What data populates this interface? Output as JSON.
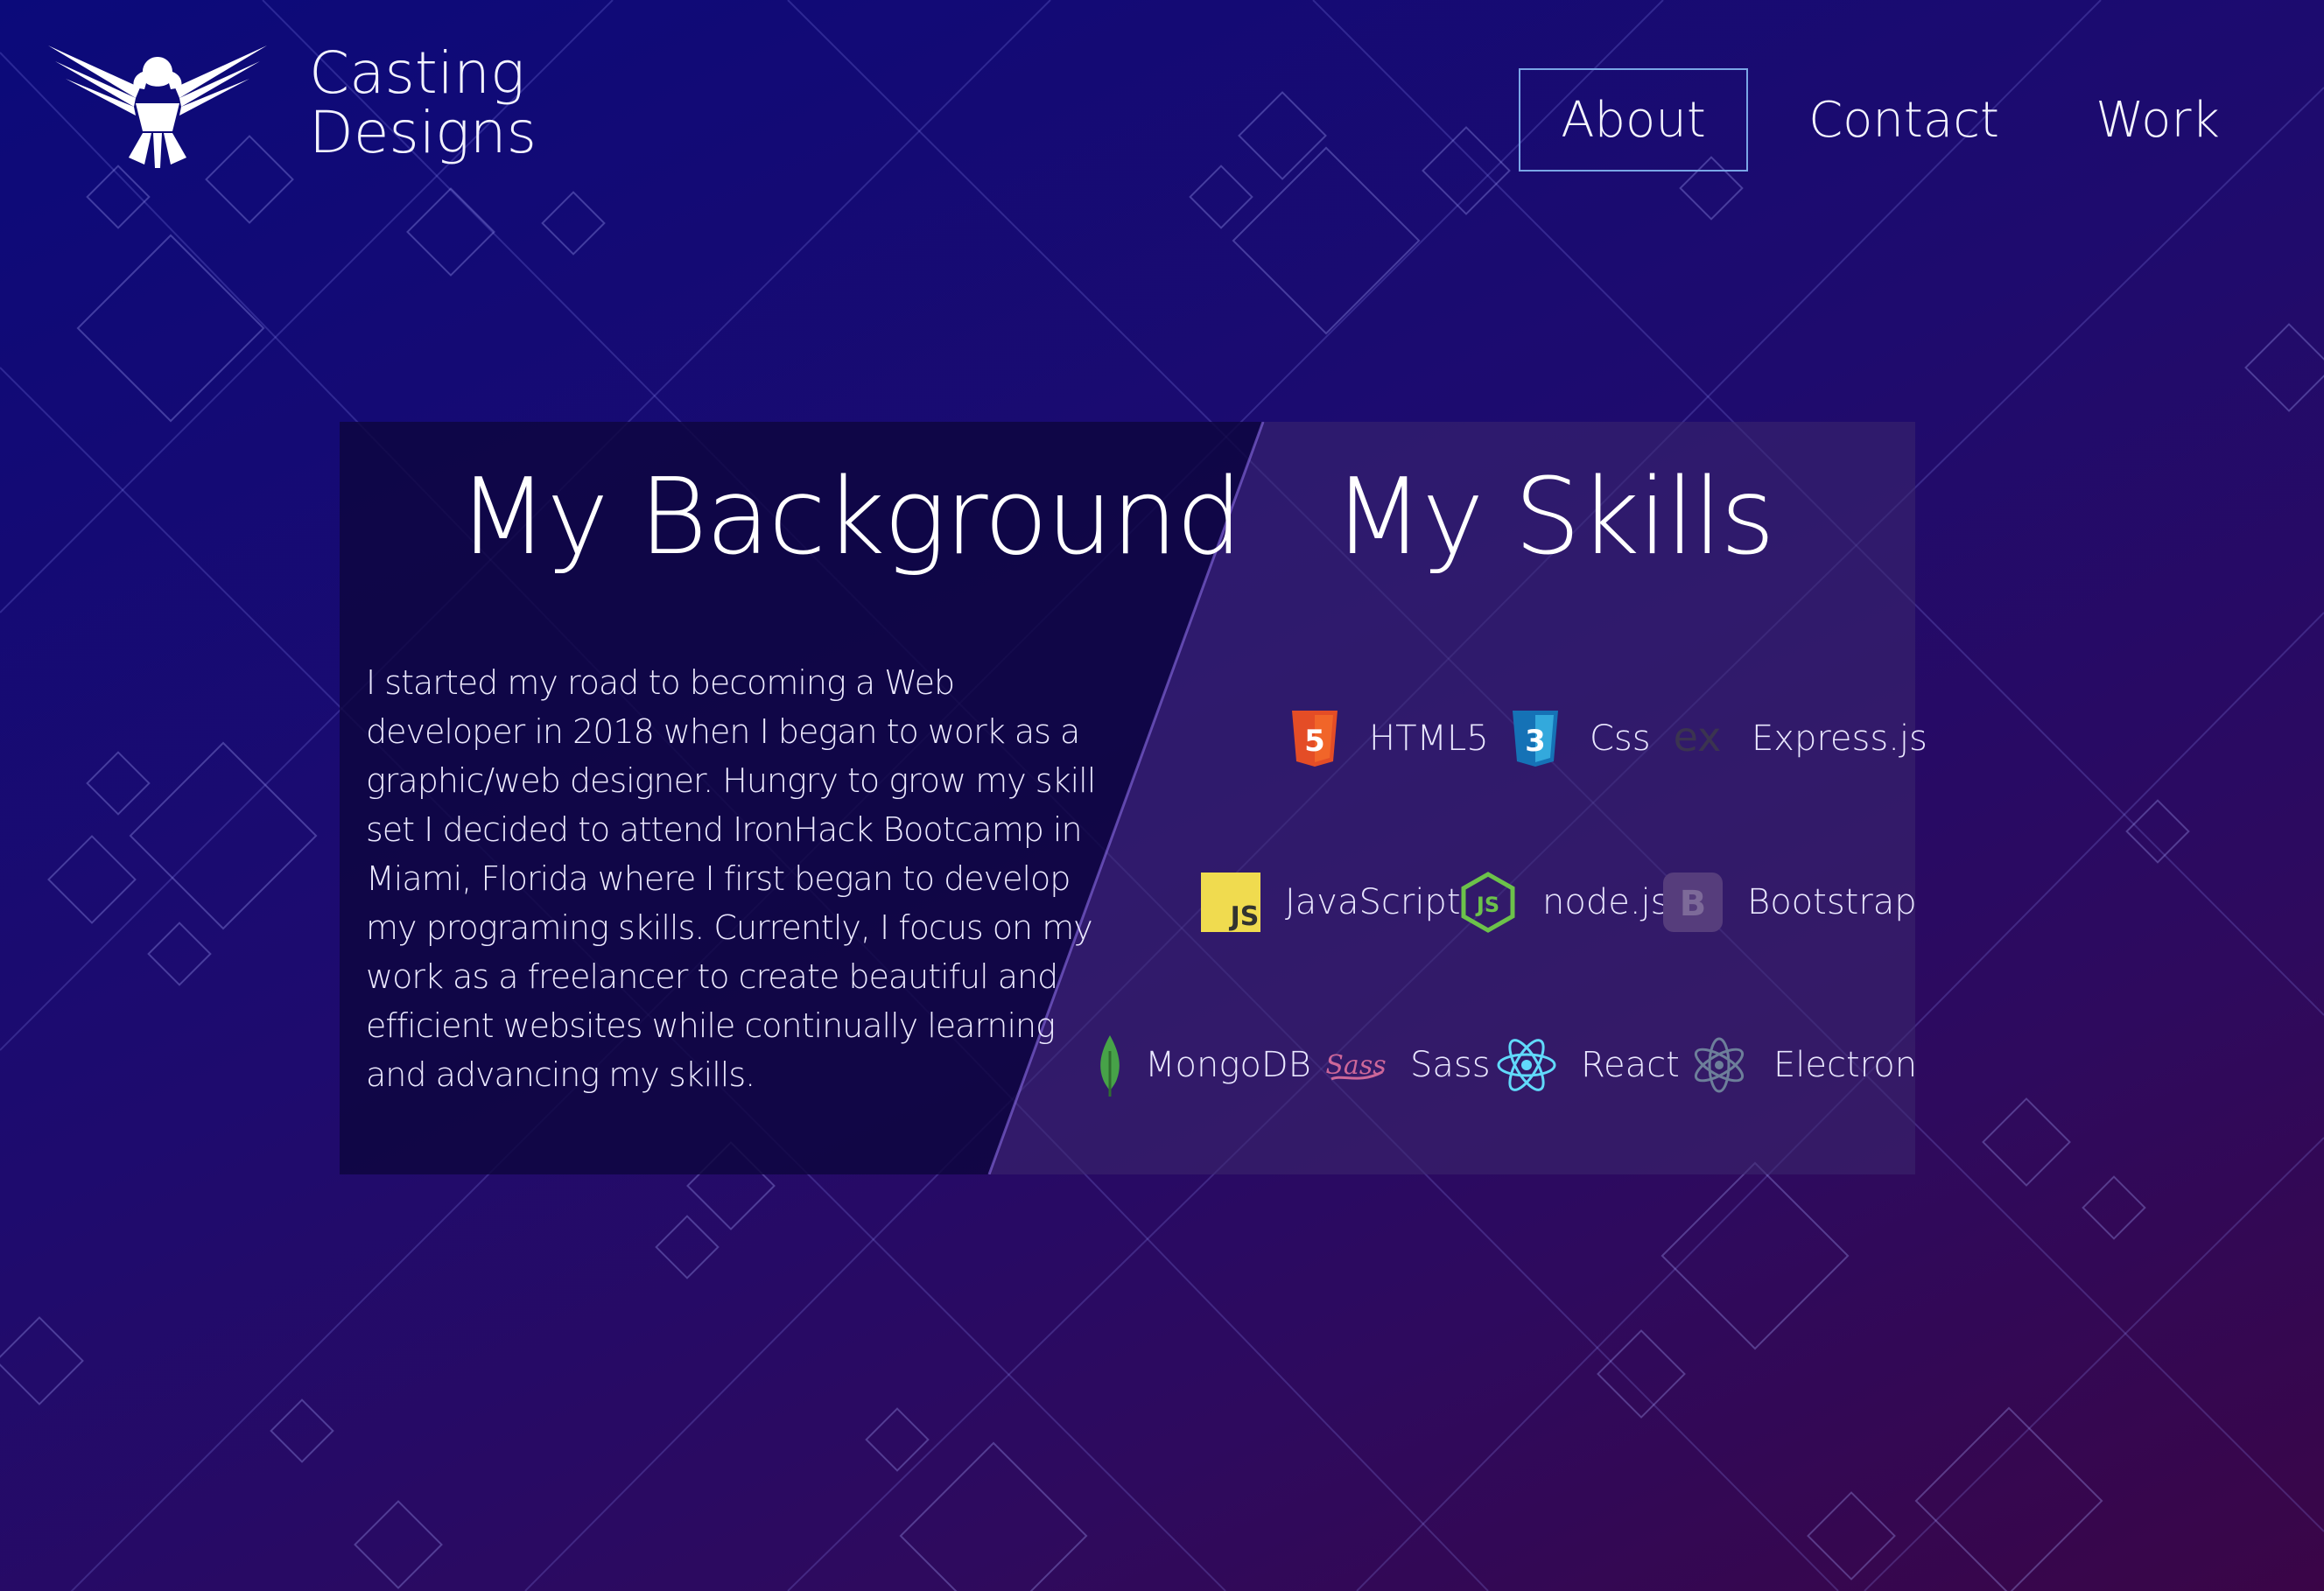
{
  "brand": {
    "line1": "Casting",
    "line2": "Designs"
  },
  "nav": {
    "items": [
      {
        "label": "About",
        "active": true
      },
      {
        "label": "Contact"
      },
      {
        "label": "Work"
      }
    ]
  },
  "background_section": {
    "title": "My Background",
    "text": "I started my road to becoming a Web developer in 2018 when I began to work as a graphic/web designer. Hungry to grow my skill set I decided to attend IronHack Bootcamp in Miami, Florida where I first began to develop my programing skills. Currently, I focus on my work as a freelancer to create beautiful and efficient websites while continually learning and advancing my skills."
  },
  "skills_section": {
    "title": "My Skills",
    "skills": [
      {
        "label": "HTML5",
        "icon": "html5-icon"
      },
      {
        "label": "Css",
        "icon": "css3-icon"
      },
      {
        "label": "Express.js",
        "icon": "express-icon"
      },
      {
        "label": "JavaScript",
        "icon": "javascript-icon"
      },
      {
        "label": "node.js",
        "icon": "nodejs-icon"
      },
      {
        "label": "Bootstrap",
        "icon": "bootstrap-icon"
      },
      {
        "label": "MongoDB",
        "icon": "mongodb-icon"
      },
      {
        "label": "Sass",
        "icon": "sass-icon"
      },
      {
        "label": "React",
        "icon": "react-icon"
      },
      {
        "label": "Electron",
        "icon": "electron-icon"
      }
    ]
  },
  "colors": {
    "nav_active_border": "#7aa6e6",
    "background_start": "#0b0a7a",
    "background_end": "#3a0547"
  }
}
